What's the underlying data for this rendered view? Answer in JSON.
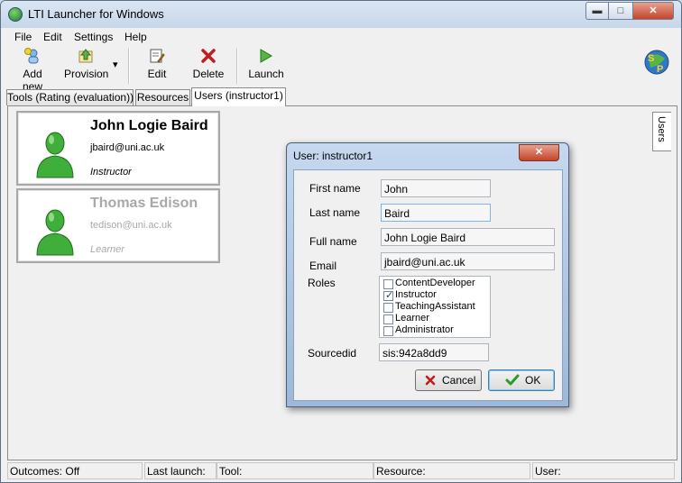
{
  "window": {
    "title": "LTI Launcher for Windows",
    "min_glyph": "▬",
    "max_glyph": "□",
    "close_glyph": "✕"
  },
  "menu": [
    "File",
    "Edit",
    "Settings",
    "Help"
  ],
  "toolbar": {
    "add_new": "Add new",
    "provision": "Provision",
    "provision_arrow": "▾",
    "edit": "Edit",
    "delete": "Delete",
    "launch": "Launch"
  },
  "tabs": [
    "Tools (Rating (evaluation))",
    "Resources",
    "Users (instructor1)"
  ],
  "active_tab": 2,
  "side_tab": "Users",
  "users": [
    {
      "name": "John Logie Baird",
      "email": "jbaird@uni.ac.uk",
      "role": "Instructor",
      "dimmed": false
    },
    {
      "name": "Thomas Edison",
      "email": "tedison@uni.ac.uk",
      "role": "Learner",
      "dimmed": true
    }
  ],
  "dialog": {
    "title": "User: instructor1",
    "close_glyph": "✕",
    "labels": {
      "first_name": "First name",
      "last_name": "Last name",
      "full_name": "Full name",
      "email": "Email",
      "roles": "Roles",
      "sourcedid": "Sourcedid"
    },
    "values": {
      "first_name": "John",
      "last_name": "Baird",
      "full_name": "John Logie Baird",
      "email": "jbaird@uni.ac.uk",
      "sourcedid": "sis:942a8dd9"
    },
    "roles": [
      {
        "label": "ContentDeveloper",
        "checked": false
      },
      {
        "label": "Instructor",
        "checked": true
      },
      {
        "label": "TeachingAssistant",
        "checked": false
      },
      {
        "label": "Learner",
        "checked": false
      },
      {
        "label": "Administrator",
        "checked": false
      }
    ],
    "cancel_label": "Cancel",
    "ok_label": "OK",
    "check_glyph": "✓"
  },
  "status": {
    "outcomes": "Outcomes: Off",
    "last_launch": "Last launch:",
    "tool": "Tool:",
    "resource": "Resource:",
    "user": "User:"
  },
  "colors": {
    "title_bar": "#c6d6ea",
    "close_red": "#c4442a",
    "accent_blue": "#3c7fb1"
  }
}
